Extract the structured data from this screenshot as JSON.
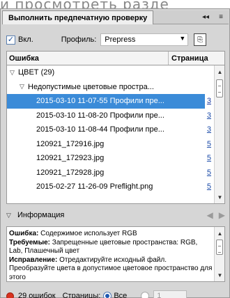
{
  "background_heading": "и просмотреть разде",
  "panel": {
    "title": "Выполнить предпечатную проверку",
    "collapse_glyph": "◂◂",
    "menu_glyph": "≡"
  },
  "controls": {
    "enabled_label": "Вкл.",
    "enabled_checked": true,
    "profile_label": "Профиль:",
    "profile_value": "Prepress"
  },
  "table": {
    "col_error": "Ошибка",
    "col_page": "Страница",
    "rows": [
      {
        "text": "ЦВЕТ (29)",
        "page": "",
        "level": 0,
        "expanded": true,
        "selected": false
      },
      {
        "text": "Недопустимые цветовые простра...",
        "page": "",
        "level": 1,
        "expanded": true,
        "selected": false
      },
      {
        "text": "2015-03-10 11-07-55 Профили пре...",
        "page": "3",
        "level": 2,
        "selected": true
      },
      {
        "text": "2015-03-10 11-08-20 Профили пре...",
        "page": "3",
        "level": 2,
        "selected": false
      },
      {
        "text": "2015-03-10 11-08-44 Профили пре...",
        "page": "3",
        "level": 2,
        "selected": false
      },
      {
        "text": "120921_172916.jpg",
        "page": "5",
        "level": 2,
        "selected": false
      },
      {
        "text": "120921_172923.jpg",
        "page": "5",
        "level": 2,
        "selected": false
      },
      {
        "text": "120921_172928.jpg",
        "page": "5",
        "level": 2,
        "selected": false
      },
      {
        "text": "2015-02-27 11-26-09 Preflight.png",
        "page": "5",
        "level": 2,
        "selected": false
      }
    ]
  },
  "info": {
    "header": "Информация",
    "error_label": "Ошибка:",
    "error_text": "Содержимое использует RGB",
    "required_label": "Требуемые:",
    "required_text": "Запрещенные цветовые пространства: RGB, Lab, Плашечный цвет",
    "fix_label": "Исправление:",
    "fix_text": "Отредактируйте исходный файл. Преобразуйте цвета в допустимое цветовое пространство для этого"
  },
  "status": {
    "errors": "29 ошибок",
    "pages_label": "Страницы:",
    "all_label": "Все",
    "range_value": "1",
    "all_selected": true
  },
  "colors": {
    "selection": "#3b8bd8",
    "error_dot": "#d8321f",
    "link": "#1a4aa8"
  }
}
